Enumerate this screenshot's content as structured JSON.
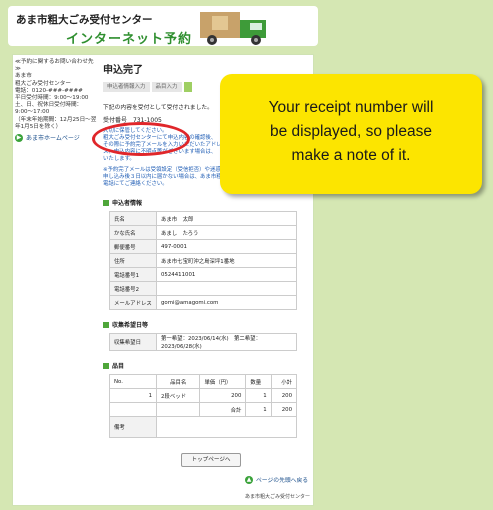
{
  "header": {
    "title": "あま市粗大ごみ受付センター",
    "subtitle": "インターネット予約"
  },
  "sidebar": {
    "contact_text": "≪予約に関するお問い合わせ先≫\nあま市\n粗大ごみ受付センター\n電話：0120-###-####\n平日受付時間：9:00〜19:00\n土、日、祝休日受付時間：9:00〜17:00\n（年末年始期間：12月25日〜翌年1月5日を除く）",
    "home_link": "あま市ホームページ"
  },
  "main": {
    "title": "申込完了",
    "steps": [
      "申込者情報入力",
      "品目入力",
      ""
    ],
    "message": "下記の内容を受付として受付されました。",
    "receipt_label": "受付番号",
    "receipt_number": "731-1005",
    "info_text": "大切に保管してください。\n粗大ごみ受付センターにて申込内容の確認後、\nその際に予約完了メールを入力いただいたアドレ\nス、申込内容に不明点等がございます場合は、\nいたします。",
    "note_text": "※予約完了メールは受領設定（受信拒否）や迷惑\n申し込み後３日以内に届かない場合は、あま市粗\n電話にてご連絡ください。"
  },
  "applicant": {
    "heading": "申込者情報",
    "rows": [
      {
        "label": "氏名",
        "value": "あま市　太郎"
      },
      {
        "label": "かな氏名",
        "value": "あまし　たろう"
      },
      {
        "label": "郵便番号",
        "value": "497-0001"
      },
      {
        "label": "住所",
        "value": "あま市七宝町沖之島深坪1番地"
      },
      {
        "label": "電話番号1",
        "value": "0524411001"
      },
      {
        "label": "電話番号2",
        "value": ""
      },
      {
        "label": "メールアドレス",
        "value": "gomi@amagomi.com"
      }
    ]
  },
  "collection": {
    "heading": "収集希望日等",
    "label": "収集希望日",
    "value": "第一希望：2023/06/14(水)　第二希望：2023/06/28(水)"
  },
  "items": {
    "heading": "品目",
    "columns": [
      "No.",
      "品目名",
      "単価（円）",
      "数量",
      "小計"
    ],
    "rows": [
      {
        "no": "1",
        "name": "2段ベッド",
        "price": "200",
        "qty": "1",
        "subtotal": "200"
      }
    ],
    "total_label": "合計",
    "total_qty": "1",
    "total_amount": "200",
    "remarks_label": "備考"
  },
  "buttons": {
    "top_page": "トップページへ",
    "back_to_top": "ページの先頭へ戻る"
  },
  "footer": "あま市粗大ごみ受付センター",
  "callout": {
    "text": "Your receipt number will\nbe displayed, so please\nmake a note of it."
  },
  "colors": {
    "accent_green": "#4ea63a",
    "callout_yellow": "#fce500",
    "highlight_red": "#e0262a"
  }
}
